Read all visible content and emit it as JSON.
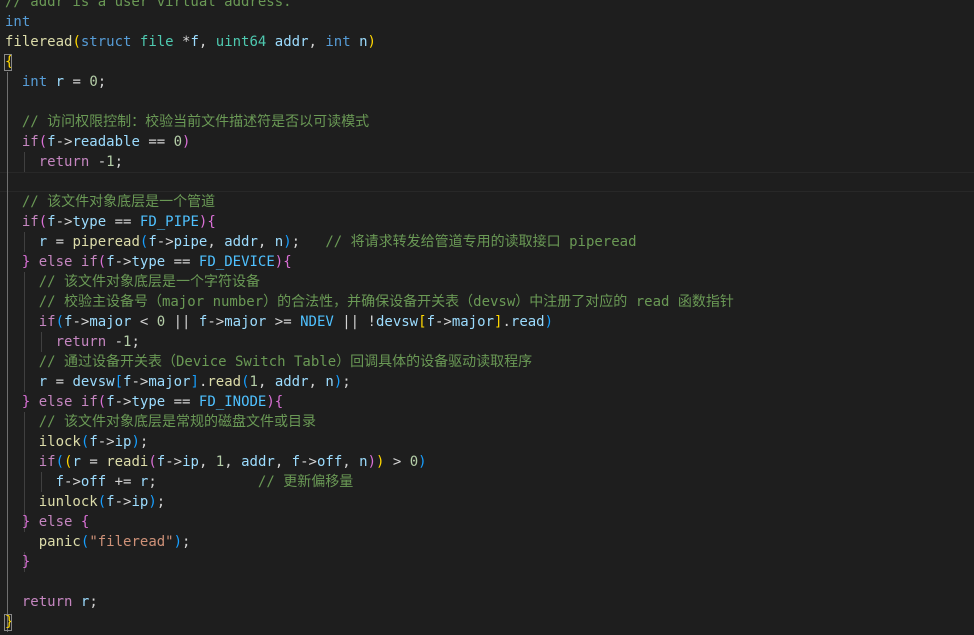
{
  "editor": {
    "lines": [
      [
        {
          "t": "// addr is a user virtual address.",
          "c": "cmt"
        }
      ],
      [
        {
          "t": "int",
          "c": "kw"
        }
      ],
      [
        {
          "t": "fileread",
          "c": "fn"
        },
        {
          "t": "(",
          "c": "b1"
        },
        {
          "t": "struct",
          "c": "kw"
        },
        {
          "t": " ",
          "c": "plain"
        },
        {
          "t": "file",
          "c": "type"
        },
        {
          "t": " *",
          "c": "plain"
        },
        {
          "t": "f",
          "c": "param"
        },
        {
          "t": ", ",
          "c": "plain"
        },
        {
          "t": "uint64",
          "c": "type"
        },
        {
          "t": " ",
          "c": "plain"
        },
        {
          "t": "addr",
          "c": "param"
        },
        {
          "t": ", ",
          "c": "plain"
        },
        {
          "t": "int",
          "c": "kw"
        },
        {
          "t": " ",
          "c": "plain"
        },
        {
          "t": "n",
          "c": "param"
        },
        {
          "t": ")",
          "c": "b1"
        }
      ],
      [
        {
          "t": "{",
          "c": "b1"
        }
      ],
      [
        {
          "t": "  ",
          "c": "plain"
        },
        {
          "t": "int",
          "c": "kw"
        },
        {
          "t": " ",
          "c": "plain"
        },
        {
          "t": "r",
          "c": "var"
        },
        {
          "t": " = ",
          "c": "plain"
        },
        {
          "t": "0",
          "c": "num"
        },
        {
          "t": ";",
          "c": "plain"
        }
      ],
      [],
      [
        {
          "t": "  ",
          "c": "plain"
        },
        {
          "t": "// 访问权限控制：校验当前文件描述符是否以可读模式",
          "c": "cmt"
        }
      ],
      [
        {
          "t": "  ",
          "c": "plain"
        },
        {
          "t": "if",
          "c": "ctl"
        },
        {
          "t": "(",
          "c": "b2"
        },
        {
          "t": "f",
          "c": "param"
        },
        {
          "t": "->",
          "c": "plain"
        },
        {
          "t": "readable",
          "c": "var"
        },
        {
          "t": " == ",
          "c": "plain"
        },
        {
          "t": "0",
          "c": "num"
        },
        {
          "t": ")",
          "c": "b2"
        }
      ],
      [
        {
          "t": "    ",
          "c": "plain"
        },
        {
          "t": "return",
          "c": "ctl"
        },
        {
          "t": " -",
          "c": "plain"
        },
        {
          "t": "1",
          "c": "num"
        },
        {
          "t": ";",
          "c": "plain"
        }
      ],
      [],
      [
        {
          "t": "  ",
          "c": "plain"
        },
        {
          "t": "// 该文件对象底层是一个管道",
          "c": "cmt"
        }
      ],
      [
        {
          "t": "  ",
          "c": "plain"
        },
        {
          "t": "if",
          "c": "ctl"
        },
        {
          "t": "(",
          "c": "b2"
        },
        {
          "t": "f",
          "c": "param"
        },
        {
          "t": "->",
          "c": "plain"
        },
        {
          "t": "type",
          "c": "var"
        },
        {
          "t": " == ",
          "c": "plain"
        },
        {
          "t": "FD_PIPE",
          "c": "const"
        },
        {
          "t": ")",
          "c": "b2"
        },
        {
          "t": "{",
          "c": "b2"
        }
      ],
      [
        {
          "t": "    ",
          "c": "plain"
        },
        {
          "t": "r",
          "c": "var"
        },
        {
          "t": " = ",
          "c": "plain"
        },
        {
          "t": "piperead",
          "c": "fn"
        },
        {
          "t": "(",
          "c": "b3"
        },
        {
          "t": "f",
          "c": "param"
        },
        {
          "t": "->",
          "c": "plain"
        },
        {
          "t": "pipe",
          "c": "var"
        },
        {
          "t": ", ",
          "c": "plain"
        },
        {
          "t": "addr",
          "c": "param"
        },
        {
          "t": ", ",
          "c": "plain"
        },
        {
          "t": "n",
          "c": "param"
        },
        {
          "t": ")",
          "c": "b3"
        },
        {
          "t": ";   ",
          "c": "plain"
        },
        {
          "t": "// 将请求转发给管道专用的读取接口 piperead",
          "c": "cmt"
        }
      ],
      [
        {
          "t": "  ",
          "c": "plain"
        },
        {
          "t": "}",
          "c": "b2"
        },
        {
          "t": " ",
          "c": "plain"
        },
        {
          "t": "else",
          "c": "ctl"
        },
        {
          "t": " ",
          "c": "plain"
        },
        {
          "t": "if",
          "c": "ctl"
        },
        {
          "t": "(",
          "c": "b2"
        },
        {
          "t": "f",
          "c": "param"
        },
        {
          "t": "->",
          "c": "plain"
        },
        {
          "t": "type",
          "c": "var"
        },
        {
          "t": " == ",
          "c": "plain"
        },
        {
          "t": "FD_DEVICE",
          "c": "const"
        },
        {
          "t": ")",
          "c": "b2"
        },
        {
          "t": "{",
          "c": "b2"
        }
      ],
      [
        {
          "t": "    ",
          "c": "plain"
        },
        {
          "t": "// 该文件对象底层是一个字符设备",
          "c": "cmt"
        }
      ],
      [
        {
          "t": "    ",
          "c": "plain"
        },
        {
          "t": "// 校验主设备号（major number）的合法性，并确保设备开关表（devsw）中注册了对应的 read 函数指针",
          "c": "cmt"
        }
      ],
      [
        {
          "t": "    ",
          "c": "plain"
        },
        {
          "t": "if",
          "c": "ctl"
        },
        {
          "t": "(",
          "c": "b3"
        },
        {
          "t": "f",
          "c": "param"
        },
        {
          "t": "->",
          "c": "plain"
        },
        {
          "t": "major",
          "c": "var"
        },
        {
          "t": " < ",
          "c": "plain"
        },
        {
          "t": "0",
          "c": "num"
        },
        {
          "t": " || ",
          "c": "plain"
        },
        {
          "t": "f",
          "c": "param"
        },
        {
          "t": "->",
          "c": "plain"
        },
        {
          "t": "major",
          "c": "var"
        },
        {
          "t": " >= ",
          "c": "plain"
        },
        {
          "t": "NDEV",
          "c": "const"
        },
        {
          "t": " || !",
          "c": "plain"
        },
        {
          "t": "devsw",
          "c": "var"
        },
        {
          "t": "[",
          "c": "b1"
        },
        {
          "t": "f",
          "c": "param"
        },
        {
          "t": "->",
          "c": "plain"
        },
        {
          "t": "major",
          "c": "var"
        },
        {
          "t": "]",
          "c": "b1"
        },
        {
          "t": ".",
          "c": "plain"
        },
        {
          "t": "read",
          "c": "var"
        },
        {
          "t": ")",
          "c": "b3"
        }
      ],
      [
        {
          "t": "      ",
          "c": "plain"
        },
        {
          "t": "return",
          "c": "ctl"
        },
        {
          "t": " -",
          "c": "plain"
        },
        {
          "t": "1",
          "c": "num"
        },
        {
          "t": ";",
          "c": "plain"
        }
      ],
      [
        {
          "t": "    ",
          "c": "plain"
        },
        {
          "t": "// 通过设备开关表（Device Switch Table）回调具体的设备驱动读取程序",
          "c": "cmt"
        }
      ],
      [
        {
          "t": "    ",
          "c": "plain"
        },
        {
          "t": "r",
          "c": "var"
        },
        {
          "t": " = ",
          "c": "plain"
        },
        {
          "t": "devsw",
          "c": "var"
        },
        {
          "t": "[",
          "c": "b3"
        },
        {
          "t": "f",
          "c": "param"
        },
        {
          "t": "->",
          "c": "plain"
        },
        {
          "t": "major",
          "c": "var"
        },
        {
          "t": "]",
          "c": "b3"
        },
        {
          "t": ".",
          "c": "plain"
        },
        {
          "t": "read",
          "c": "fn"
        },
        {
          "t": "(",
          "c": "b3"
        },
        {
          "t": "1",
          "c": "num"
        },
        {
          "t": ", ",
          "c": "plain"
        },
        {
          "t": "addr",
          "c": "param"
        },
        {
          "t": ", ",
          "c": "plain"
        },
        {
          "t": "n",
          "c": "param"
        },
        {
          "t": ")",
          "c": "b3"
        },
        {
          "t": ";",
          "c": "plain"
        }
      ],
      [
        {
          "t": "  ",
          "c": "plain"
        },
        {
          "t": "}",
          "c": "b2"
        },
        {
          "t": " ",
          "c": "plain"
        },
        {
          "t": "else",
          "c": "ctl"
        },
        {
          "t": " ",
          "c": "plain"
        },
        {
          "t": "if",
          "c": "ctl"
        },
        {
          "t": "(",
          "c": "b2"
        },
        {
          "t": "f",
          "c": "param"
        },
        {
          "t": "->",
          "c": "plain"
        },
        {
          "t": "type",
          "c": "var"
        },
        {
          "t": " == ",
          "c": "plain"
        },
        {
          "t": "FD_INODE",
          "c": "const"
        },
        {
          "t": ")",
          "c": "b2"
        },
        {
          "t": "{",
          "c": "b2"
        }
      ],
      [
        {
          "t": "    ",
          "c": "plain"
        },
        {
          "t": "// 该文件对象底层是常规的磁盘文件或目录",
          "c": "cmt"
        }
      ],
      [
        {
          "t": "    ",
          "c": "plain"
        },
        {
          "t": "ilock",
          "c": "fn"
        },
        {
          "t": "(",
          "c": "b3"
        },
        {
          "t": "f",
          "c": "param"
        },
        {
          "t": "->",
          "c": "plain"
        },
        {
          "t": "ip",
          "c": "var"
        },
        {
          "t": ")",
          "c": "b3"
        },
        {
          "t": ";",
          "c": "plain"
        }
      ],
      [
        {
          "t": "    ",
          "c": "plain"
        },
        {
          "t": "if",
          "c": "ctl"
        },
        {
          "t": "(",
          "c": "b3"
        },
        {
          "t": "(",
          "c": "b1"
        },
        {
          "t": "r",
          "c": "var"
        },
        {
          "t": " = ",
          "c": "plain"
        },
        {
          "t": "readi",
          "c": "fn"
        },
        {
          "t": "(",
          "c": "b2"
        },
        {
          "t": "f",
          "c": "param"
        },
        {
          "t": "->",
          "c": "plain"
        },
        {
          "t": "ip",
          "c": "var"
        },
        {
          "t": ", ",
          "c": "plain"
        },
        {
          "t": "1",
          "c": "num"
        },
        {
          "t": ", ",
          "c": "plain"
        },
        {
          "t": "addr",
          "c": "param"
        },
        {
          "t": ", ",
          "c": "plain"
        },
        {
          "t": "f",
          "c": "param"
        },
        {
          "t": "->",
          "c": "plain"
        },
        {
          "t": "off",
          "c": "var"
        },
        {
          "t": ", ",
          "c": "plain"
        },
        {
          "t": "n",
          "c": "param"
        },
        {
          "t": ")",
          "c": "b2"
        },
        {
          "t": ")",
          "c": "b1"
        },
        {
          "t": " > ",
          "c": "plain"
        },
        {
          "t": "0",
          "c": "num"
        },
        {
          "t": ")",
          "c": "b3"
        }
      ],
      [
        {
          "t": "      ",
          "c": "plain"
        },
        {
          "t": "f",
          "c": "param"
        },
        {
          "t": "->",
          "c": "plain"
        },
        {
          "t": "off",
          "c": "var"
        },
        {
          "t": " += ",
          "c": "plain"
        },
        {
          "t": "r",
          "c": "var"
        },
        {
          "t": ";            ",
          "c": "plain"
        },
        {
          "t": "// 更新偏移量",
          "c": "cmt"
        }
      ],
      [
        {
          "t": "    ",
          "c": "plain"
        },
        {
          "t": "iunlock",
          "c": "fn"
        },
        {
          "t": "(",
          "c": "b3"
        },
        {
          "t": "f",
          "c": "param"
        },
        {
          "t": "->",
          "c": "plain"
        },
        {
          "t": "ip",
          "c": "var"
        },
        {
          "t": ")",
          "c": "b3"
        },
        {
          "t": ";",
          "c": "plain"
        }
      ],
      [
        {
          "t": "  ",
          "c": "plain"
        },
        {
          "t": "}",
          "c": "b2"
        },
        {
          "t": " ",
          "c": "plain"
        },
        {
          "t": "else",
          "c": "ctl"
        },
        {
          "t": " ",
          "c": "plain"
        },
        {
          "t": "{",
          "c": "b2"
        }
      ],
      [
        {
          "t": "    ",
          "c": "plain"
        },
        {
          "t": "panic",
          "c": "fn"
        },
        {
          "t": "(",
          "c": "b3"
        },
        {
          "t": "\"fileread\"",
          "c": "str"
        },
        {
          "t": ")",
          "c": "b3"
        },
        {
          "t": ";",
          "c": "plain"
        }
      ],
      [
        {
          "t": "  ",
          "c": "plain"
        },
        {
          "t": "}",
          "c": "b2"
        }
      ],
      [],
      [
        {
          "t": "  ",
          "c": "plain"
        },
        {
          "t": "return",
          "c": "ctl"
        },
        {
          "t": " ",
          "c": "plain"
        },
        {
          "t": "r",
          "c": "var"
        },
        {
          "t": ";",
          "c": "plain"
        }
      ],
      [
        {
          "t": "}",
          "c": "b1"
        }
      ]
    ]
  }
}
